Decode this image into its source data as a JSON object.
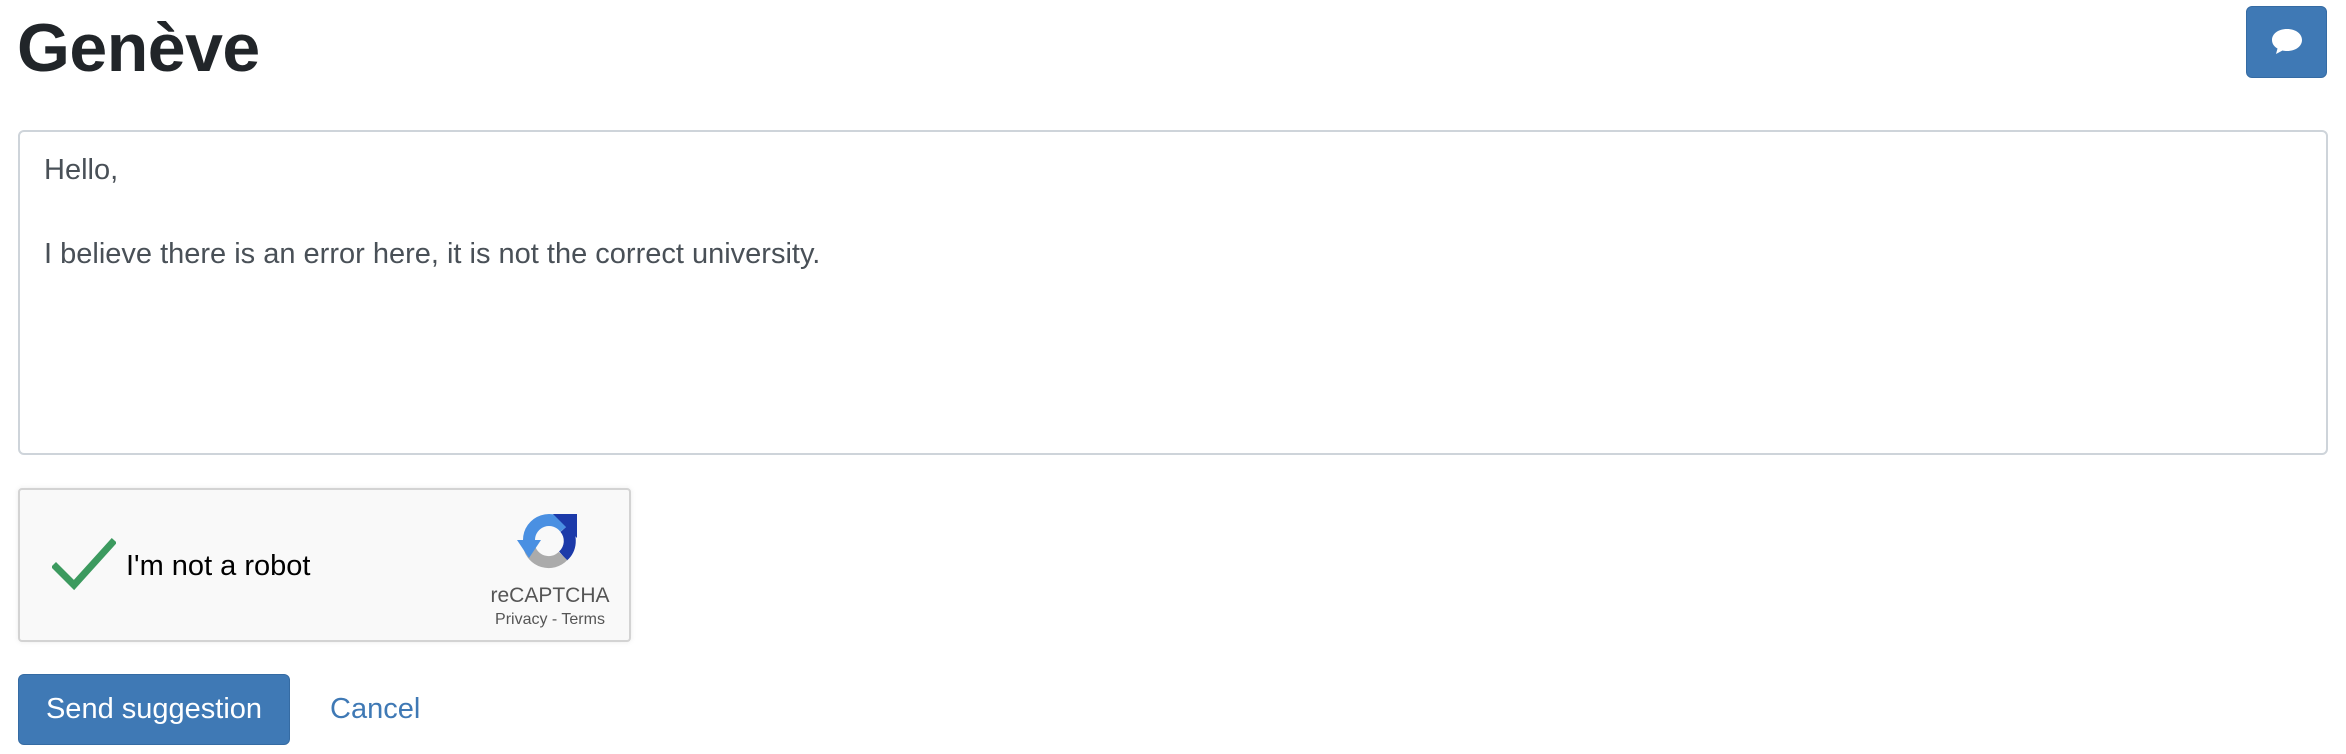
{
  "header": {
    "title": "Genève",
    "feedback_icon": "speech-bubble-icon"
  },
  "form": {
    "message_value": "Hello,\n\nI believe there is an error here, it is not the correct university.",
    "recaptcha": {
      "checked": true,
      "label": "I'm not a robot",
      "brand": "reCAPTCHA",
      "privacy_label": "Privacy",
      "separator": " - ",
      "terms_label": "Terms"
    },
    "send_label": "Send suggestion",
    "cancel_label": "Cancel"
  },
  "colors": {
    "primary": "#3f79b5",
    "check_green": "#3c9a5f",
    "text": "#212529",
    "input_text": "#495057",
    "input_border": "#ced4da"
  }
}
